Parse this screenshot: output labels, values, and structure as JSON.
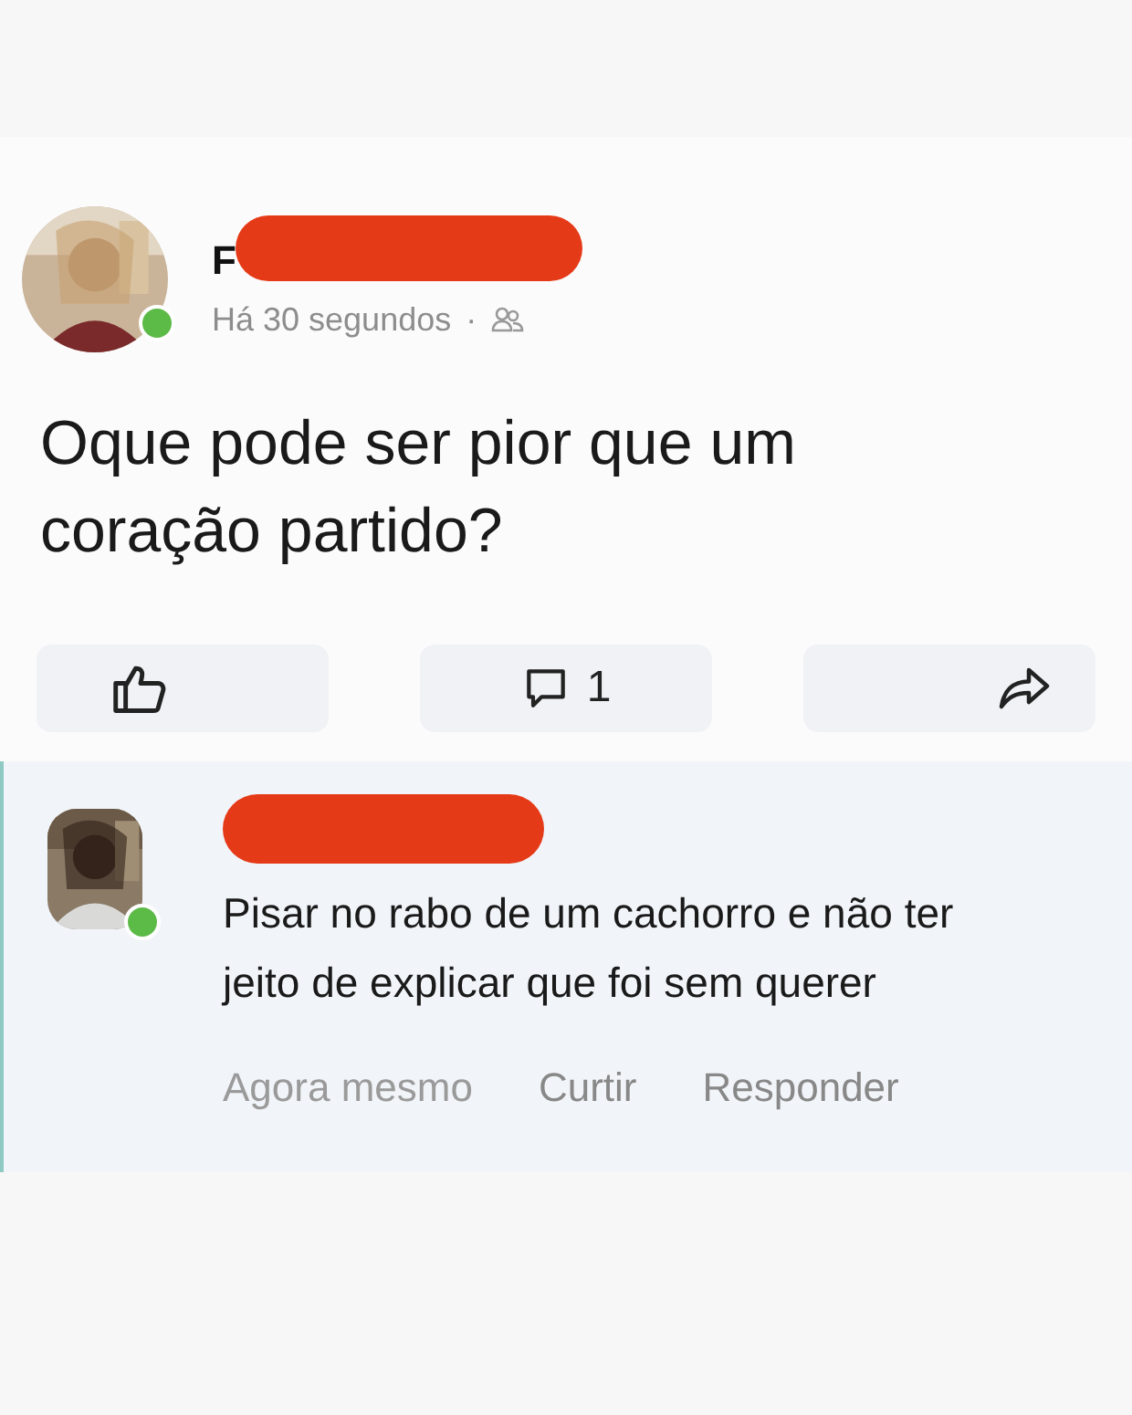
{
  "post": {
    "author": {
      "name": "F",
      "online": true
    },
    "time": "Há 30 segundos",
    "separator": "·",
    "text": "Oque pode ser pior que um coração partido?",
    "actions": [
      {
        "kind": "like"
      },
      {
        "kind": "comment",
        "count": "1"
      },
      {
        "kind": "share"
      }
    ]
  },
  "comment": {
    "author": {
      "online": true
    },
    "text": "Pisar no rabo de um cachorro e não ter jeito de explicar que foi sem querer",
    "time": "Agora mesmo",
    "actions": [
      "Curtir",
      "Responder"
    ]
  }
}
